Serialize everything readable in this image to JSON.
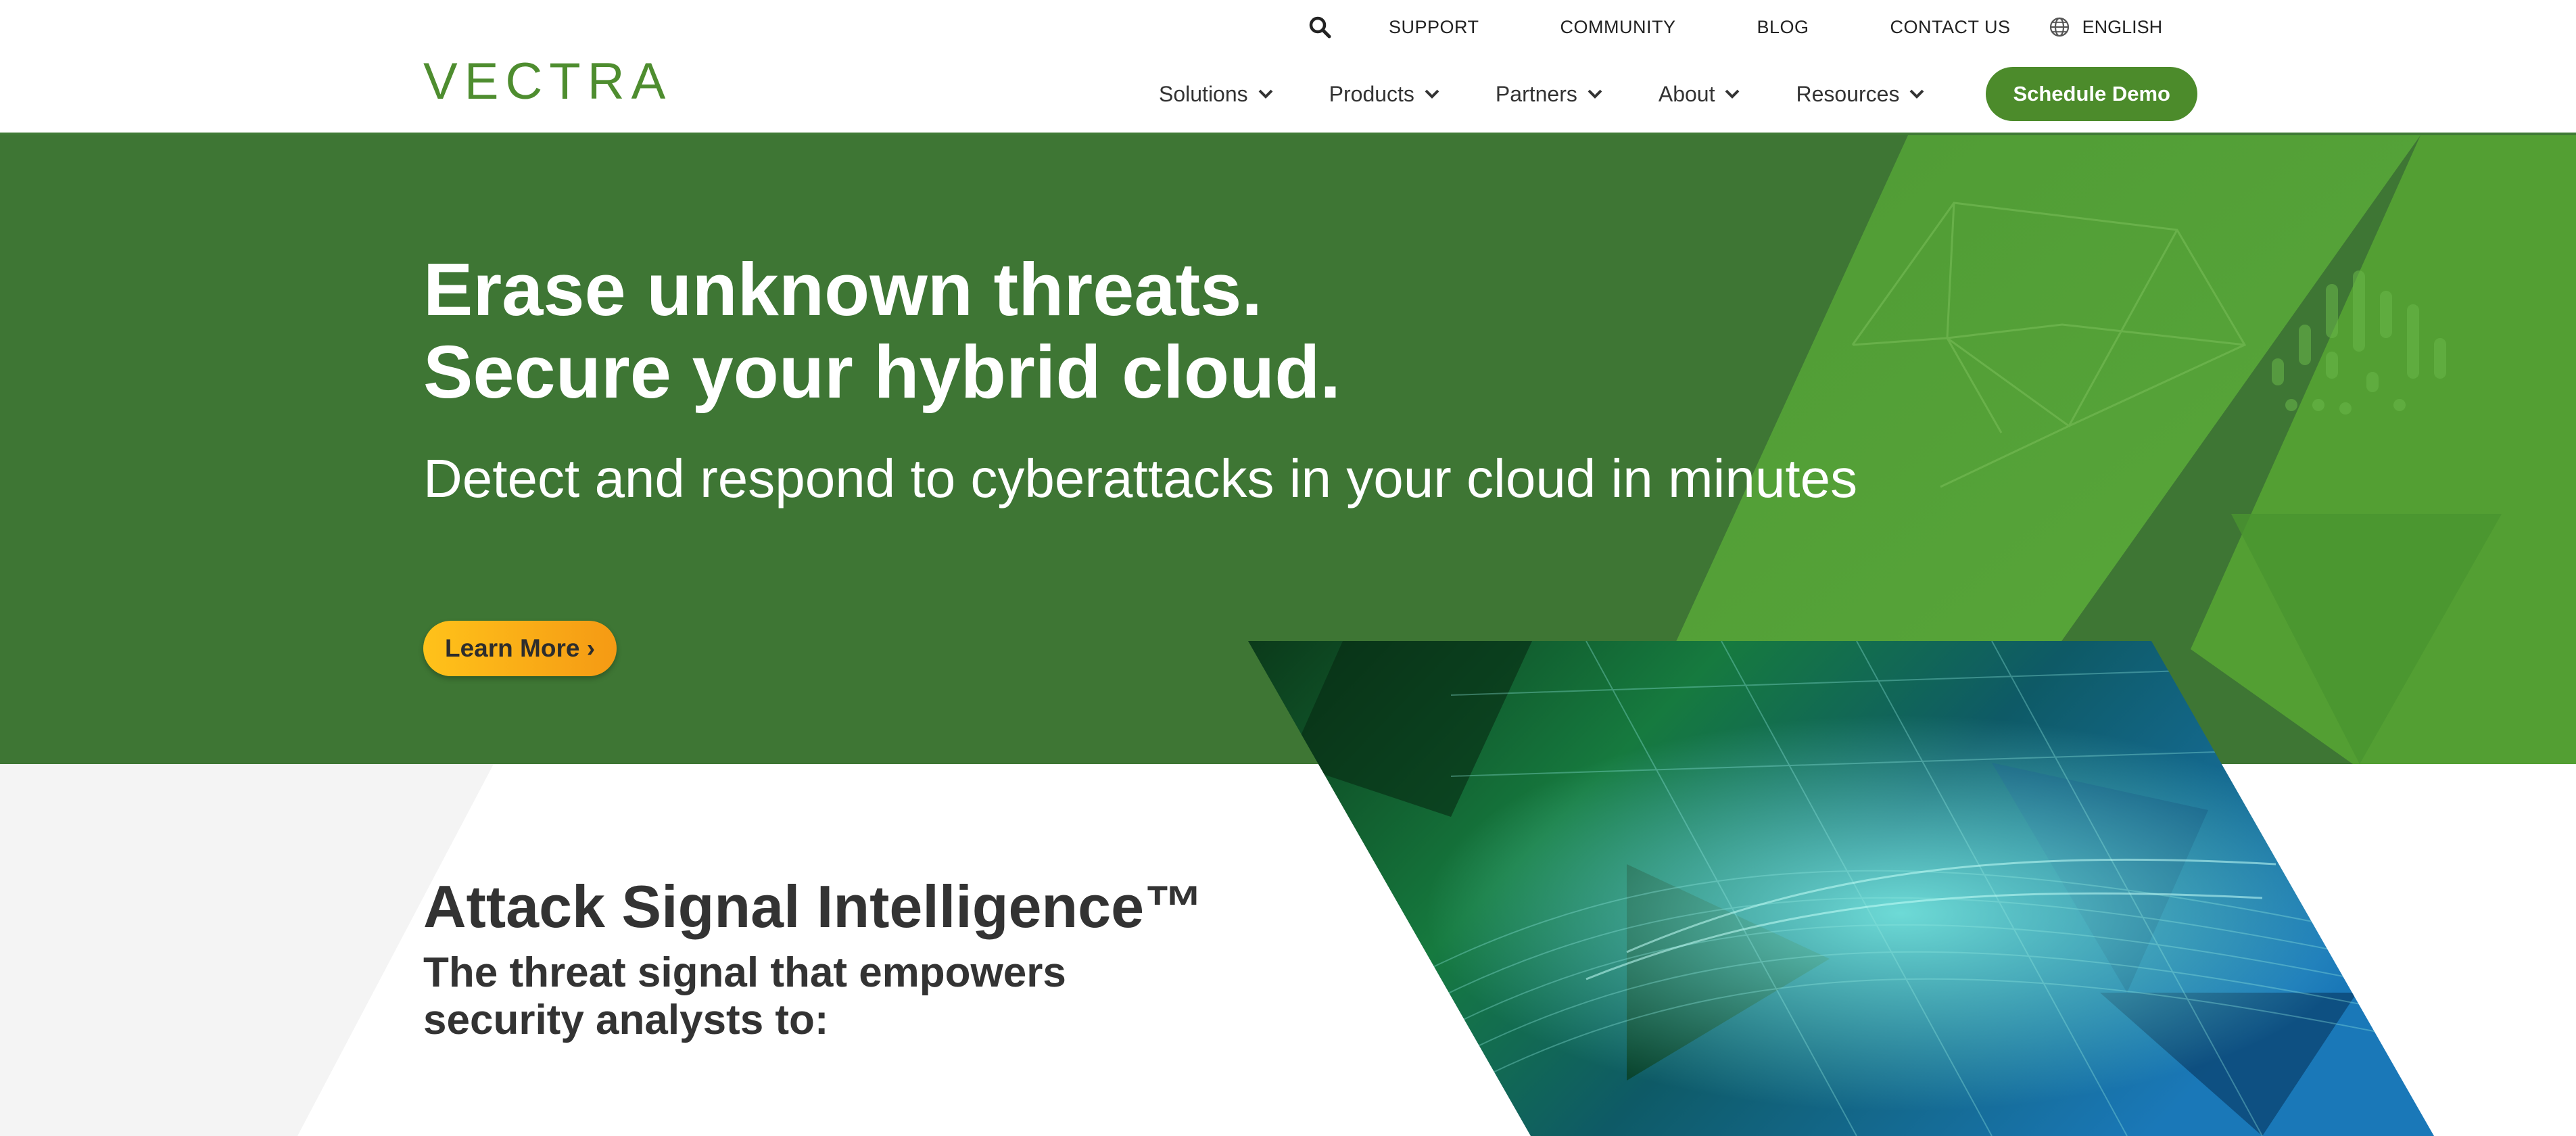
{
  "header": {
    "logo_text": "VECTRA",
    "utility_links": [
      "SUPPORT",
      "COMMUNITY",
      "BLOG",
      "CONTACT US"
    ],
    "language": "ENGLISH",
    "nav": [
      {
        "label": "Solutions"
      },
      {
        "label": "Products"
      },
      {
        "label": "Partners"
      },
      {
        "label": "About"
      },
      {
        "label": "Resources"
      }
    ],
    "cta_label": "Schedule Demo"
  },
  "hero": {
    "title_line1": "Erase unknown threats.",
    "title_line2": "Secure your hybrid cloud.",
    "subtitle": "Detect and respond to cyberattacks in your cloud in minutes",
    "button_label": "Learn More ›"
  },
  "section2": {
    "title": "Attack Signal Intelligence™",
    "subtitle": "The threat signal that empowers security analysts to:"
  },
  "colors": {
    "brand_green": "#4c8b2b",
    "hero_green": "#3e7634",
    "accent_yellow": "#ffc21a",
    "teal": "#1fa3a0"
  },
  "icons": {
    "search": "search-icon",
    "language": "globe-icon",
    "dropdown": "chevron-down-icon"
  }
}
